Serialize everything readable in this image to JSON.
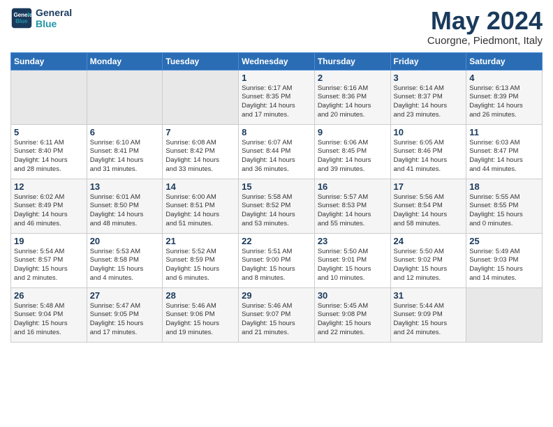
{
  "logo": {
    "line1": "General",
    "line2": "Blue"
  },
  "title": "May 2024",
  "subtitle": "Cuorgne, Piedmont, Italy",
  "days_of_week": [
    "Sunday",
    "Monday",
    "Tuesday",
    "Wednesday",
    "Thursday",
    "Friday",
    "Saturday"
  ],
  "weeks": [
    [
      {
        "day": "",
        "info": ""
      },
      {
        "day": "",
        "info": ""
      },
      {
        "day": "",
        "info": ""
      },
      {
        "day": "1",
        "info": "Sunrise: 6:17 AM\nSunset: 8:35 PM\nDaylight: 14 hours\nand 17 minutes."
      },
      {
        "day": "2",
        "info": "Sunrise: 6:16 AM\nSunset: 8:36 PM\nDaylight: 14 hours\nand 20 minutes."
      },
      {
        "day": "3",
        "info": "Sunrise: 6:14 AM\nSunset: 8:37 PM\nDaylight: 14 hours\nand 23 minutes."
      },
      {
        "day": "4",
        "info": "Sunrise: 6:13 AM\nSunset: 8:39 PM\nDaylight: 14 hours\nand 26 minutes."
      }
    ],
    [
      {
        "day": "5",
        "info": "Sunrise: 6:11 AM\nSunset: 8:40 PM\nDaylight: 14 hours\nand 28 minutes."
      },
      {
        "day": "6",
        "info": "Sunrise: 6:10 AM\nSunset: 8:41 PM\nDaylight: 14 hours\nand 31 minutes."
      },
      {
        "day": "7",
        "info": "Sunrise: 6:08 AM\nSunset: 8:42 PM\nDaylight: 14 hours\nand 33 minutes."
      },
      {
        "day": "8",
        "info": "Sunrise: 6:07 AM\nSunset: 8:44 PM\nDaylight: 14 hours\nand 36 minutes."
      },
      {
        "day": "9",
        "info": "Sunrise: 6:06 AM\nSunset: 8:45 PM\nDaylight: 14 hours\nand 39 minutes."
      },
      {
        "day": "10",
        "info": "Sunrise: 6:05 AM\nSunset: 8:46 PM\nDaylight: 14 hours\nand 41 minutes."
      },
      {
        "day": "11",
        "info": "Sunrise: 6:03 AM\nSunset: 8:47 PM\nDaylight: 14 hours\nand 44 minutes."
      }
    ],
    [
      {
        "day": "12",
        "info": "Sunrise: 6:02 AM\nSunset: 8:49 PM\nDaylight: 14 hours\nand 46 minutes."
      },
      {
        "day": "13",
        "info": "Sunrise: 6:01 AM\nSunset: 8:50 PM\nDaylight: 14 hours\nand 48 minutes."
      },
      {
        "day": "14",
        "info": "Sunrise: 6:00 AM\nSunset: 8:51 PM\nDaylight: 14 hours\nand 51 minutes."
      },
      {
        "day": "15",
        "info": "Sunrise: 5:58 AM\nSunset: 8:52 PM\nDaylight: 14 hours\nand 53 minutes."
      },
      {
        "day": "16",
        "info": "Sunrise: 5:57 AM\nSunset: 8:53 PM\nDaylight: 14 hours\nand 55 minutes."
      },
      {
        "day": "17",
        "info": "Sunrise: 5:56 AM\nSunset: 8:54 PM\nDaylight: 14 hours\nand 58 minutes."
      },
      {
        "day": "18",
        "info": "Sunrise: 5:55 AM\nSunset: 8:55 PM\nDaylight: 15 hours\nand 0 minutes."
      }
    ],
    [
      {
        "day": "19",
        "info": "Sunrise: 5:54 AM\nSunset: 8:57 PM\nDaylight: 15 hours\nand 2 minutes."
      },
      {
        "day": "20",
        "info": "Sunrise: 5:53 AM\nSunset: 8:58 PM\nDaylight: 15 hours\nand 4 minutes."
      },
      {
        "day": "21",
        "info": "Sunrise: 5:52 AM\nSunset: 8:59 PM\nDaylight: 15 hours\nand 6 minutes."
      },
      {
        "day": "22",
        "info": "Sunrise: 5:51 AM\nSunset: 9:00 PM\nDaylight: 15 hours\nand 8 minutes."
      },
      {
        "day": "23",
        "info": "Sunrise: 5:50 AM\nSunset: 9:01 PM\nDaylight: 15 hours\nand 10 minutes."
      },
      {
        "day": "24",
        "info": "Sunrise: 5:50 AM\nSunset: 9:02 PM\nDaylight: 15 hours\nand 12 minutes."
      },
      {
        "day": "25",
        "info": "Sunrise: 5:49 AM\nSunset: 9:03 PM\nDaylight: 15 hours\nand 14 minutes."
      }
    ],
    [
      {
        "day": "26",
        "info": "Sunrise: 5:48 AM\nSunset: 9:04 PM\nDaylight: 15 hours\nand 16 minutes."
      },
      {
        "day": "27",
        "info": "Sunrise: 5:47 AM\nSunset: 9:05 PM\nDaylight: 15 hours\nand 17 minutes."
      },
      {
        "day": "28",
        "info": "Sunrise: 5:46 AM\nSunset: 9:06 PM\nDaylight: 15 hours\nand 19 minutes."
      },
      {
        "day": "29",
        "info": "Sunrise: 5:46 AM\nSunset: 9:07 PM\nDaylight: 15 hours\nand 21 minutes."
      },
      {
        "day": "30",
        "info": "Sunrise: 5:45 AM\nSunset: 9:08 PM\nDaylight: 15 hours\nand 22 minutes."
      },
      {
        "day": "31",
        "info": "Sunrise: 5:44 AM\nSunset: 9:09 PM\nDaylight: 15 hours\nand 24 minutes."
      },
      {
        "day": "",
        "info": ""
      }
    ]
  ]
}
